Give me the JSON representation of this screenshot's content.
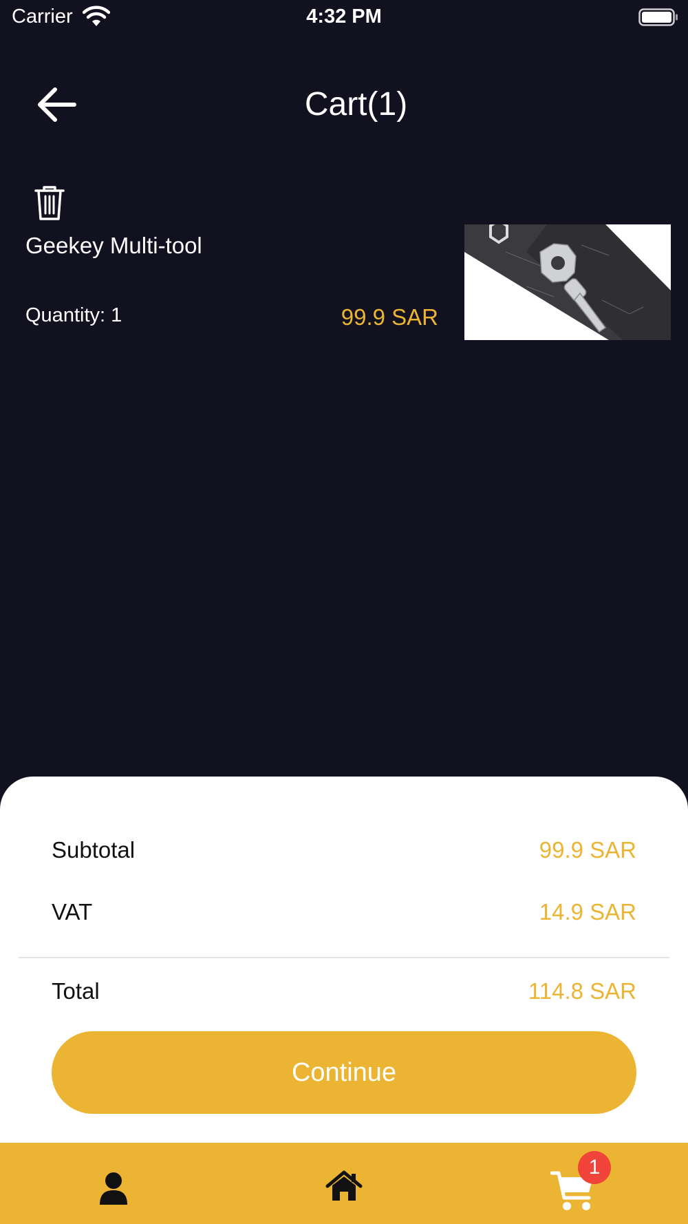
{
  "status_bar": {
    "carrier": "Carrier",
    "time": "4:32 PM",
    "icons": [
      "wifi-icon",
      "battery-icon"
    ]
  },
  "header": {
    "title": "Cart(1)",
    "back_icon": "arrow-left-icon"
  },
  "cart_items": [
    {
      "name": "Geekey Multi-tool",
      "quantity_text": "Quantity: 1",
      "price": "99.9 SAR",
      "delete_icon": "trash-icon",
      "image": "product-image"
    }
  ],
  "summary": {
    "subtotal_label": "Subtotal",
    "subtotal_value": "99.9 SAR",
    "vat_label": "VAT",
    "vat_value": "14.9 SAR",
    "total_label": "Total",
    "total_value": "114.8 SAR",
    "continue_label": "Continue"
  },
  "tab_bar": {
    "tabs": [
      "profile-icon",
      "home-icon",
      "cart-icon"
    ],
    "cart_badge": "1"
  },
  "colors": {
    "background": "#121120",
    "accent": "#ecb433",
    "sheet": "#ffffff",
    "badge": "#f0433a"
  }
}
